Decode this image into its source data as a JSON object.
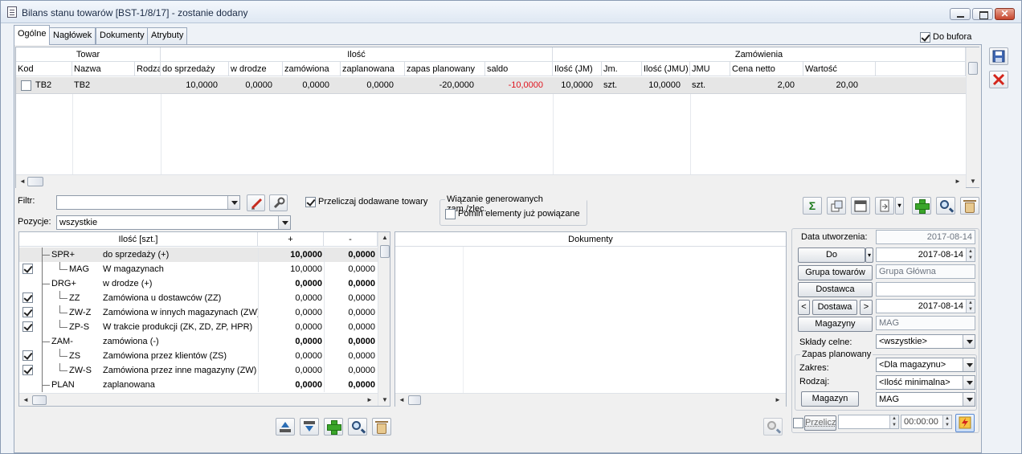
{
  "window": {
    "title": "Bilans stanu towarów [BST-1/8/17] - zostanie dodany",
    "close_glyph": "✕"
  },
  "tabs": [
    "Ogólne",
    "Nagłówek",
    "Dokumenty",
    "Atrybuty"
  ],
  "do_bufora": {
    "label": "Do bufora",
    "checked": true
  },
  "main_grid": {
    "group_headers": {
      "towar": "Towar",
      "ilosc": "Ilość",
      "zamowienia": "Zamówienia"
    },
    "columns": [
      "Kod",
      "Nazwa",
      "Rodzaj",
      "do sprzedaży",
      "w drodze",
      "zamówiona",
      "zaplanowana",
      "zapas planowany",
      "saldo",
      "Ilość (JM)",
      "Jm.",
      "Ilość (JMU)",
      "JMU",
      "Cena netto",
      "Wartość"
    ],
    "rows": [
      {
        "kod": "TB2",
        "nazwa": "TB2",
        "rodzaj": "",
        "do_sprzedazy": "10,0000",
        "w_drodze": "0,0000",
        "zamowiona": "0,0000",
        "zaplanowana": "0,0000",
        "zapas_planowany": "-20,0000",
        "saldo": "-10,0000",
        "ilosc_jm": "10,0000",
        "jm": "szt.",
        "ilosc_jmu": "10,0000",
        "jmu": "szt.",
        "cena_netto": "2,00",
        "wartosc": "20,00"
      }
    ]
  },
  "filter": {
    "label": "Filtr:",
    "value": ""
  },
  "pozycje": {
    "label": "Pozycje:",
    "value": "wszystkie"
  },
  "przeliczaj": {
    "label": "Przeliczaj dodawane towary",
    "checked": true
  },
  "wiazanie": {
    "title": "Wiązanie generowanych zam./zlec.",
    "pomin_label": "Pomiń elementy już powiązane",
    "pomin_checked": false
  },
  "tree": {
    "headers": [
      "Ilość [szt.]",
      "+",
      "-"
    ],
    "rows": [
      {
        "code": "SPR+",
        "desc": "do sprzedaży (+)",
        "plus": "10,0000",
        "minus": "0,0000",
        "bold": true,
        "checkbox": false,
        "level": 0
      },
      {
        "code": "MAG",
        "desc": "W magazynach",
        "plus": "10,0000",
        "minus": "0,0000",
        "bold": false,
        "checkbox": true,
        "level": 1
      },
      {
        "code": "DRG+",
        "desc": "w drodze (+)",
        "plus": "0,0000",
        "minus": "0,0000",
        "bold": true,
        "checkbox": false,
        "level": 0
      },
      {
        "code": "ZZ",
        "desc": "Zamówiona u dostawców (ZZ)",
        "plus": "0,0000",
        "minus": "0,0000",
        "bold": false,
        "checkbox": true,
        "level": 1
      },
      {
        "code": "ZW-Z",
        "desc": "Zamówiona w innych magazynach (ZW)",
        "plus": "0,0000",
        "minus": "0,0000",
        "bold": false,
        "checkbox": true,
        "level": 1
      },
      {
        "code": "ZP-S",
        "desc": "W trakcie produkcji (ZK, ZD, ZP, HPR)",
        "plus": "0,0000",
        "minus": "0,0000",
        "bold": false,
        "checkbox": true,
        "level": 1
      },
      {
        "code": "ZAM-",
        "desc": "zamówiona (-)",
        "plus": "0,0000",
        "minus": "0,0000",
        "bold": true,
        "checkbox": false,
        "level": 0
      },
      {
        "code": "ZS",
        "desc": "Zamówiona przez klientów (ZS)",
        "plus": "0,0000",
        "minus": "0,0000",
        "bold": false,
        "checkbox": true,
        "level": 1
      },
      {
        "code": "ZW-S",
        "desc": "Zamówiona przez inne magazyny (ZW)",
        "plus": "0,0000",
        "minus": "0,0000",
        "bold": false,
        "checkbox": true,
        "level": 1
      },
      {
        "code": "PLAN",
        "desc": "zaplanowana",
        "plus": "0,0000",
        "minus": "0,0000",
        "bold": true,
        "checkbox": false,
        "level": 0
      }
    ]
  },
  "docs": {
    "header": "Dokumenty"
  },
  "right": {
    "data_utworzenia_label": "Data utworzenia:",
    "data_utworzenia": "2017-08-14",
    "do_label": "Do",
    "do_date": "2017-08-14",
    "grupa_label": "Grupa towarów",
    "grupa_value": "Grupa Główna",
    "dostawca_label": "Dostawca",
    "dostawca_value": "",
    "dostawa_label": "Dostawa",
    "dostawa_date": "2017-08-14",
    "magazyny_label": "Magazyny",
    "magazyny_value": "MAG",
    "sklady_label": "Składy celne:",
    "sklady_value": "<wszystkie>",
    "zapas_title": "Zapas planowany",
    "zakres_label": "Zakres:",
    "zakres_value": "<Dla magazynu>",
    "rodzaj_label": "Rodzaj:",
    "rodzaj_value": "<Ilość minimalna>",
    "magazyn_label": "Magazyn",
    "magazyn_value": "MAG",
    "przelicz_label": "Przelicz",
    "time_value": "00:00:00"
  },
  "glyphs": {
    "sigma": "Σ",
    "left": "<",
    "right": ">"
  },
  "colors": {
    "negative": "#e0141e",
    "accent": "#2a6db5"
  }
}
